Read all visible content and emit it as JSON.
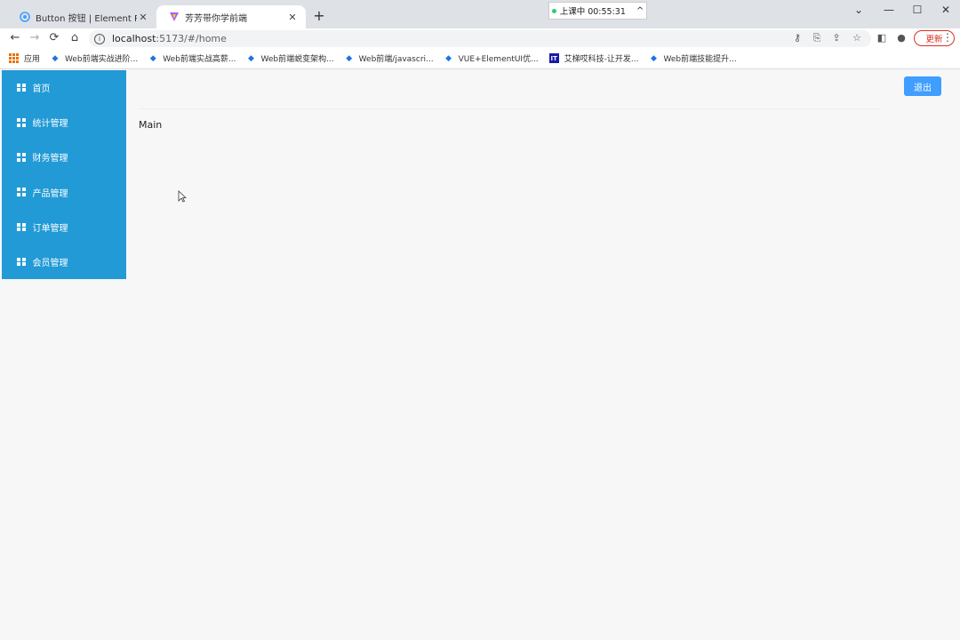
{
  "browser": {
    "tabs": [
      {
        "title": "Button 按钮 | Element Plus",
        "icon": "element-plus-icon"
      },
      {
        "title": "芳芳带你学前端",
        "icon": "vite-icon"
      }
    ],
    "new_tab": "+",
    "recording": {
      "label": "上课中 00:55:31",
      "caret": "^"
    },
    "window_controls": {
      "dropdown": "⌄",
      "minimize": "—",
      "maximize": "☐",
      "close": "✕"
    },
    "nav": {
      "back": "←",
      "forward": "→",
      "reload": "⟳",
      "home": "⌂"
    },
    "address": {
      "host": "localhost",
      "path": ":5173/#/home"
    },
    "update_label": "更新",
    "bookmarks": [
      {
        "label": "应用",
        "icon": "apps-grid-icon"
      },
      {
        "label": "Web前端实战进阶...",
        "icon": "bookmark-icon"
      },
      {
        "label": "Web前端实战高薪...",
        "icon": "bookmark-icon"
      },
      {
        "label": "Web前端蜕变架构...",
        "icon": "bookmark-icon"
      },
      {
        "label": "Web前端/javascri...",
        "icon": "bookmark-icon"
      },
      {
        "label": "VUE+ElementUI优...",
        "icon": "bookmark-icon"
      },
      {
        "label": "艾梯哎科技-让开发...",
        "icon": "it-icon",
        "badge": "IT"
      },
      {
        "label": "Web前端技能提升...",
        "icon": "bookmark-icon"
      }
    ]
  },
  "app": {
    "sidebar": {
      "items": [
        {
          "label": "首页"
        },
        {
          "label": "统计管理"
        },
        {
          "label": "财务管理"
        },
        {
          "label": "产品管理"
        },
        {
          "label": "订单管理"
        },
        {
          "label": "会员管理"
        }
      ],
      "background": "#229ad6"
    },
    "header": {
      "logout_label": "退出",
      "accent": "#409eff"
    },
    "main": {
      "text": "Main"
    }
  }
}
